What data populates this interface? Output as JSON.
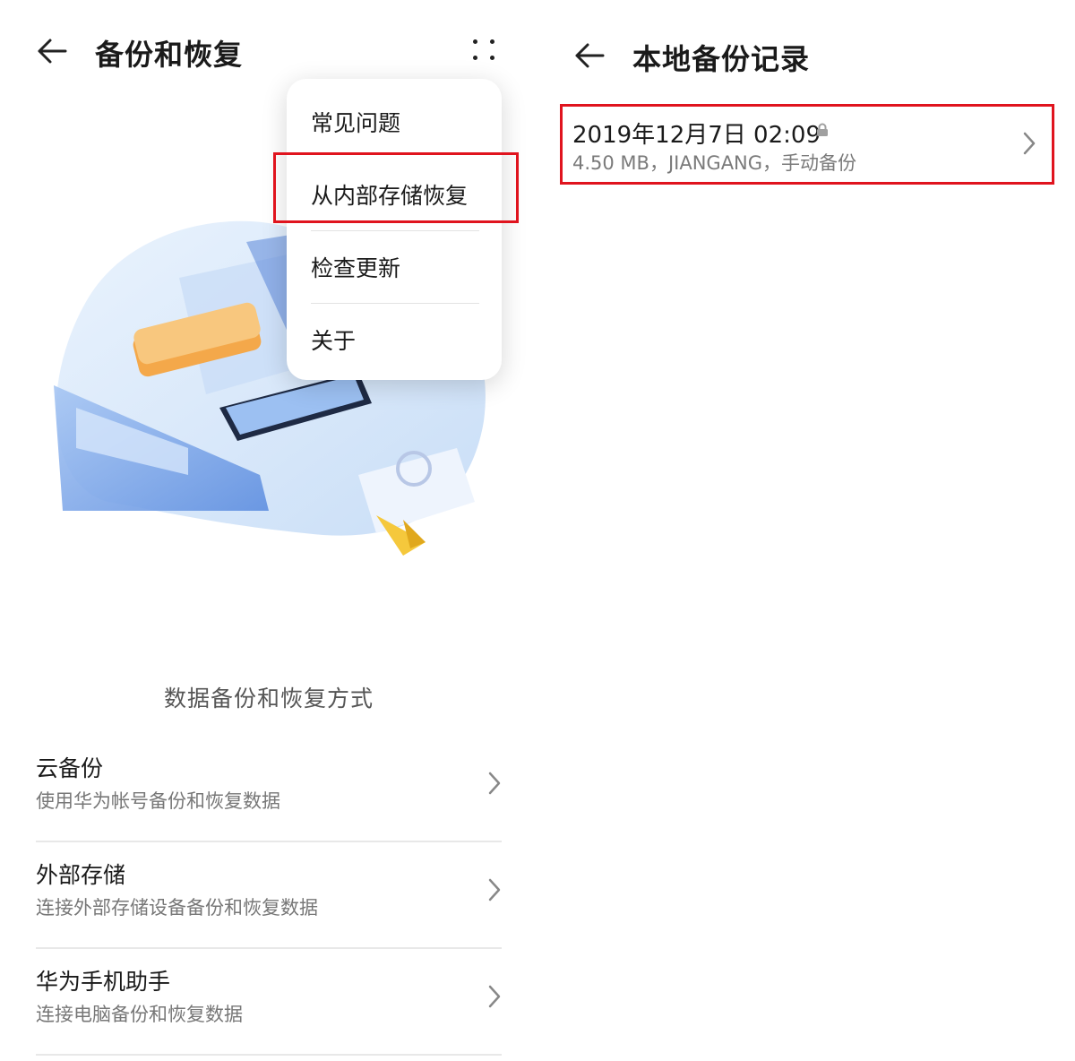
{
  "left_screen": {
    "title": "备份和恢复",
    "menu": {
      "items": [
        {
          "label": "常见问题"
        },
        {
          "label": "从内部存储恢复"
        },
        {
          "label": "检查更新"
        },
        {
          "label": "关于"
        }
      ]
    },
    "section_title": "数据备份和恢复方式",
    "options": [
      {
        "title": "云备份",
        "subtitle": "使用华为帐号备份和恢复数据"
      },
      {
        "title": "外部存储",
        "subtitle": "连接外部存储设备备份和恢复数据"
      },
      {
        "title": "华为手机助手",
        "subtitle": "连接电脑备份和恢复数据"
      }
    ]
  },
  "right_screen": {
    "title": "本地备份记录",
    "records": [
      {
        "datetime": "2019年12月7日 02:09",
        "details": "4.50 MB，JIANGANG，手动备份"
      }
    ]
  },
  "colors": {
    "highlight": "#e0141e",
    "illustration_blue": "#6f9fe6",
    "illustration_orange": "#f4a84a"
  },
  "icons": [
    "back-arrow-icon",
    "more-icon",
    "chevron-right-icon",
    "lock-icon"
  ]
}
